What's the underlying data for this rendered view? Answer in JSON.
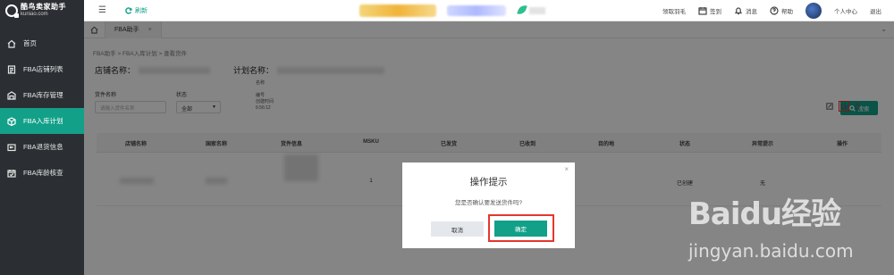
{
  "app": {
    "logo_title": "酷鸟卖家助手",
    "logo_sub": "kuniao.com"
  },
  "sidebar": {
    "items": [
      {
        "label": "首页",
        "icon": "home-icon"
      },
      {
        "label": "FBA店铺列表",
        "icon": "store-icon"
      },
      {
        "label": "FBA库存管理",
        "icon": "inventory-icon"
      },
      {
        "label": "FBA入库计划",
        "icon": "box-icon",
        "active": true
      },
      {
        "label": "FBA退货信息",
        "icon": "return-icon"
      },
      {
        "label": "FBA库龄核查",
        "icon": "calendar-check-icon"
      }
    ]
  },
  "topbar": {
    "refresh": "刷新",
    "claim_points": "领取羽毛",
    "checkin": "签到",
    "messages": "消息",
    "help": "帮助",
    "user_center": "个人中心",
    "logout": "退出"
  },
  "tabs": [
    {
      "label": "FBA助手",
      "close": "×"
    }
  ],
  "tab_scroll_icon": "chevron-down-icon",
  "breadcrumb": "FBA助手 > FBA入库计划 > 查看货件",
  "titles": {
    "store_label": "店铺名称：",
    "plan_label": "计划名称："
  },
  "filters": {
    "shipment_name_label": "货件名称",
    "shipment_name_placeholder": "请输入货件名称",
    "status_label": "状态",
    "status_value": "全部",
    "search_button": "搜索"
  },
  "table": {
    "headers": [
      "店铺名称",
      "国家名称",
      "货件信息",
      "MSKU",
      "已发货",
      "已收到",
      "目的地",
      "状态",
      "异常提示",
      "操作"
    ],
    "row": {
      "ship_info_lines": [
        "名称",
        "编号",
        "创建时间",
        "6:56:12"
      ],
      "msku": "1",
      "status": "已创建",
      "exception": "无"
    }
  },
  "dialog": {
    "title": "操作提示",
    "message": "您是否确认要发送货件吗?",
    "cancel": "取消",
    "confirm": "确定",
    "close": "×"
  },
  "watermark": {
    "brand": "Baidu经验",
    "url": "jingyan.baidu.com"
  },
  "colors": {
    "accent": "#13a089",
    "sidebar_bg": "#2b2f33",
    "highlight": "#e4362f"
  }
}
